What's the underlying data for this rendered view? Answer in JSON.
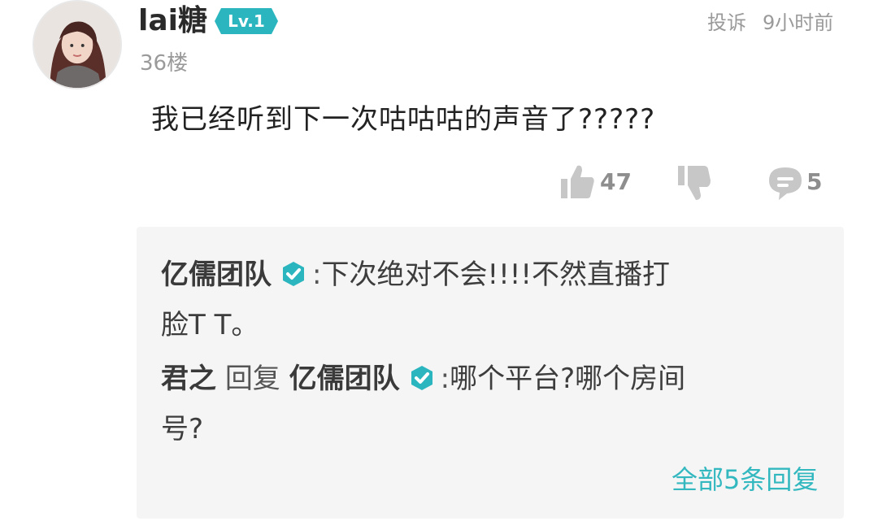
{
  "comment": {
    "username": "lai糖",
    "level": "Lv.1",
    "floor": "36楼",
    "report_label": "投诉",
    "time": "9小时前",
    "text": "我已经听到下一次咕咕咕的声音了?????",
    "likes": "47",
    "replies_count": "5",
    "icons": {
      "avatar": "avatar-photo",
      "like": "thumbs-up-icon",
      "dislike": "thumbs-down-icon",
      "reply": "speech-bubble-icon",
      "verified": "verified-check-icon"
    }
  },
  "replies": [
    {
      "author": "亿儒团队",
      "verified": true,
      "separator": ":",
      "text_line1": "下次绝对不会!!!!不然直播打",
      "text_line2": "脸T T。"
    },
    {
      "author": "君之",
      "reply_word": "回复",
      "target": "亿儒团队",
      "verified": true,
      "separator": ":",
      "text_line1": "哪个平台?哪个房间",
      "text_line2": "号?"
    }
  ],
  "all_replies_link": "全部5条回复",
  "colors": {
    "accent": "#33b8c0",
    "reply_bg": "#f5f5f5",
    "muted": "#9a9a9a"
  }
}
